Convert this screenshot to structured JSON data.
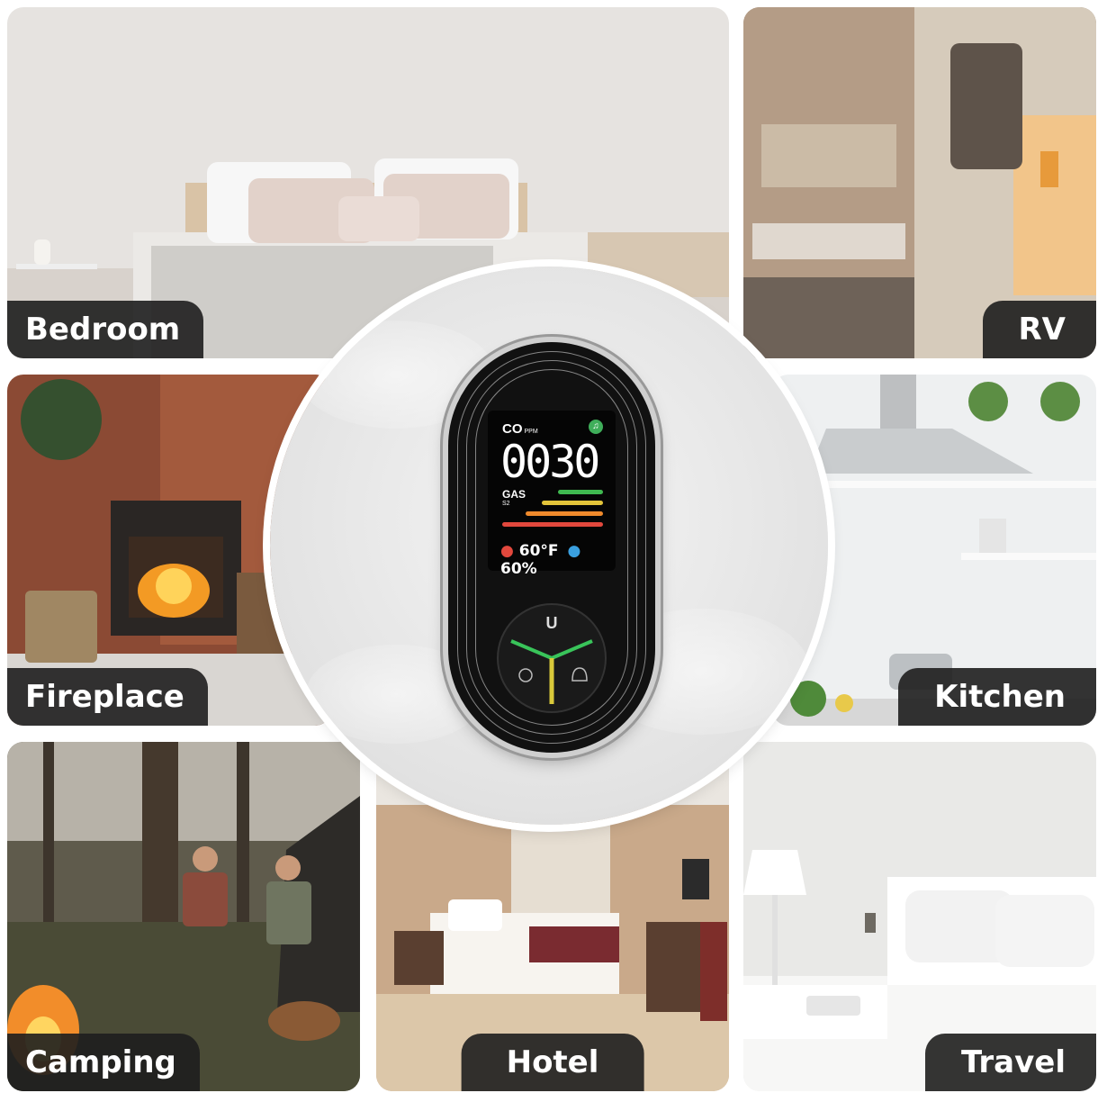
{
  "tiles": {
    "bedroom": {
      "label": "Bedroom"
    },
    "rv": {
      "label": "RV"
    },
    "fireplace": {
      "label": "Fireplace"
    },
    "kitchen": {
      "label": "Kitchen"
    },
    "camping": {
      "label": "Camping"
    },
    "hotel": {
      "label": "Hotel"
    },
    "travel": {
      "label": "Travel"
    }
  },
  "device": {
    "co_label": "CO",
    "ppm_label": "PPM",
    "reading": "0030",
    "gas_label": "GAS",
    "sensor_label": "S2",
    "temperature": "60°F",
    "humidity": "60%",
    "button_label": "U"
  },
  "colors": {
    "label_bg": "#1e1e1e",
    "bar_green": "#3fb950",
    "bar_yellow": "#e3c43a",
    "bar_orange": "#f08a2c",
    "bar_red": "#e2483d"
  }
}
